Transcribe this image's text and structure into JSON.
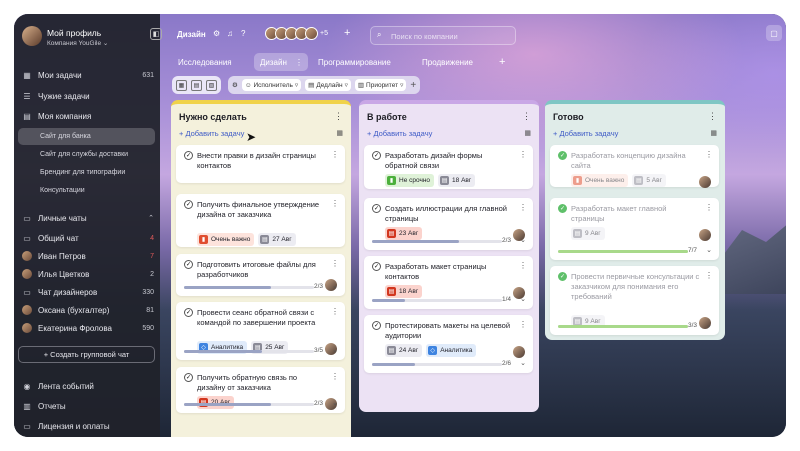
{
  "profile": {
    "name": "Мой профиль",
    "company": "Компания YouGile ⌄"
  },
  "sidebar": {
    "items": [
      {
        "label": "Мои задачи",
        "count": "631",
        "icon": "grid-icon"
      },
      {
        "label": "Чужие задачи",
        "count": "",
        "icon": "list-icon"
      },
      {
        "label": "Моя компания",
        "count": "",
        "icon": "building-icon"
      }
    ],
    "projects": [
      "Сайт для банка",
      "Сайт для службы доставки",
      "Брендинг для типографии",
      "Консультации"
    ],
    "chats_header": "Личные чаты",
    "chats": [
      {
        "label": "Общий чат",
        "count": "4",
        "count_color": "#e05a5a"
      },
      {
        "label": "Иван Петров",
        "count": "7",
        "count_color": "#e05a5a"
      },
      {
        "label": "Илья Цветков",
        "count": "2",
        "count_color": "#c7c8d0"
      },
      {
        "label": "Чат дизайнеров",
        "count": "330",
        "count_color": "#c7c8d0"
      },
      {
        "label": "Оксана (бухгалтер)",
        "count": "81",
        "count_color": "#c7c8d0"
      },
      {
        "label": "Екатерина Фролова",
        "count": "590",
        "count_color": "#c7c8d0"
      }
    ],
    "create_chat": "+  Создать групповой чат",
    "bottom": [
      "Лента событий",
      "Отчеты",
      "Лицензия и оплаты"
    ]
  },
  "topbar": {
    "project": "Дизайн",
    "more_users": "+5",
    "search_placeholder": "Поиск по компании"
  },
  "tabs": [
    "Исследования",
    "Дизайн",
    "Программирование",
    "Продвижение"
  ],
  "toolbar": {
    "filters": [
      "Исполнитель",
      "Дедлайн",
      "Приоритет"
    ]
  },
  "columns": [
    {
      "title": "Нужно сделать",
      "add": "Добавить задачу",
      "accent": "#f0d24a",
      "bg": "#f4f1dc",
      "cards": [
        {
          "title": "Внести правки в дизайн страницы контактов",
          "tags": []
        },
        {
          "title": "Получить финальное утверждение дизайна от заказчика",
          "tags": [
            {
              "label": "Очень важно",
              "kind": "priority-high"
            },
            {
              "label": "27 Авг",
              "kind": "date"
            }
          ]
        },
        {
          "title": "Подготовить итоговые файлы для разработчиков",
          "progress": "2/3",
          "fill": 0.67
        },
        {
          "title": "Провести сеанс обратной связи с командой по завершении проекта",
          "tags": [
            {
              "label": "Аналитика",
              "kind": "analytics"
            },
            {
              "label": "25 Авг",
              "kind": "date"
            }
          ],
          "progress": "3/5",
          "fill": 0.6
        },
        {
          "title": "Получить обратную связь по дизайну от заказчика",
          "tags": [
            {
              "label": "20 Авг",
              "kind": "date-red"
            }
          ],
          "progress": "2/3",
          "fill": 0.67
        }
      ]
    },
    {
      "title": "В работе",
      "add": "Добавить задачу",
      "accent": "#c9a7e6",
      "bg": "#ece2f4",
      "cards": [
        {
          "title": "Разработать дизайн формы обратной связи",
          "tags": [
            {
              "label": "Не срочно",
              "kind": "priority-low"
            },
            {
              "label": "18 Авг",
              "kind": "date"
            }
          ]
        },
        {
          "title": "Создать иллюстрации для главной страницы",
          "tags": [
            {
              "label": "23 Авг",
              "kind": "date-red"
            }
          ],
          "progress": "2/3",
          "fill": 0.67
        },
        {
          "title": "Разработать макет страницы контактов",
          "tags": [
            {
              "label": "18 Авг",
              "kind": "date-red"
            }
          ],
          "progress": "1/4",
          "fill": 0.25
        },
        {
          "title": "Протестировать макеты на целевой аудитории",
          "tags": [
            {
              "label": "24 Авг",
              "kind": "date"
            },
            {
              "label": "Аналитика",
              "kind": "analytics"
            }
          ],
          "progress": "2/6",
          "fill": 0.33
        }
      ]
    },
    {
      "title": "Готово",
      "add": "Добавить задачу",
      "accent": "#7fc6c4",
      "bg": "#e0ece9",
      "cards": [
        {
          "title": "Разработать концепцию дизайна сайта",
          "tags": [
            {
              "label": "Очень важно",
              "kind": "priority-high"
            },
            {
              "label": "5 Авг",
              "kind": "date"
            }
          ]
        },
        {
          "title": "Разработать макет главной страницы",
          "tags": [
            {
              "label": "9 Авг",
              "kind": "date"
            }
          ],
          "progress": "7/7",
          "fill": 1
        },
        {
          "title": "Провести первичные консультации с заказчиком для понимания его требований",
          "tags": [
            {
              "label": "9 Авг",
              "kind": "date"
            }
          ],
          "progress": "3/3",
          "fill": 1
        }
      ]
    }
  ]
}
